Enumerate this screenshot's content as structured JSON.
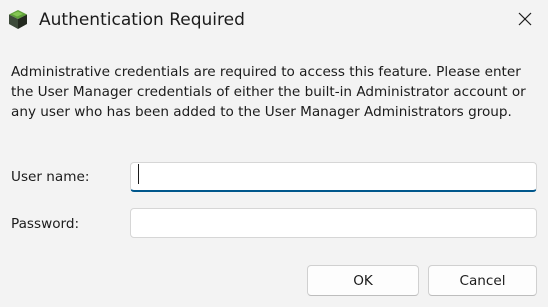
{
  "window": {
    "title": "Authentication Required",
    "app_icon": "user-manager-cube-icon",
    "close_icon": "close-icon"
  },
  "dialog": {
    "description": "Administrative credentials are required to access this feature. Please enter the User Manager credentials of either the built-in Administrator account or any user who has been added to the User Manager Administrators group.",
    "username": {
      "label": "User name:",
      "value": ""
    },
    "password": {
      "label": "Password:",
      "value": ""
    }
  },
  "buttons": {
    "ok": "OK",
    "cancel": "Cancel"
  },
  "colors": {
    "background": "#f3f3f3",
    "focus_accent": "#00578c"
  }
}
